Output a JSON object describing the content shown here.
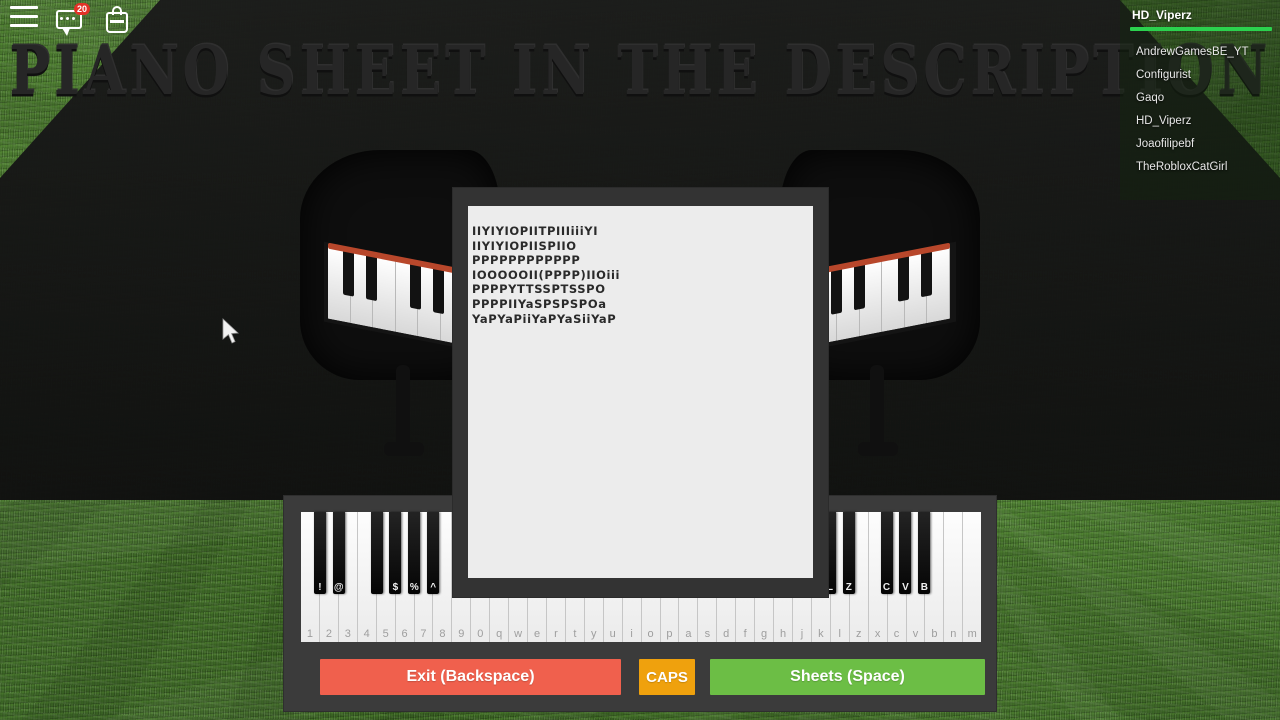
{
  "game": {
    "banner_text": "PIANO SHEET IN THE DESCRIPTION",
    "accent_colors": {
      "grass": "#3f6b2a",
      "backdrop": "#171717",
      "exit_button": "#f0604d",
      "caps_button": "#efa10d",
      "sheets_button": "#6cbe45",
      "health_bar": "#2bd14e",
      "chat_badge": "#e33227",
      "piano_felt": "#b8472b",
      "sheet_paper": "#ececec",
      "gui_frame": "#3b3b3b"
    }
  },
  "topbar": {
    "menu_icon": "hamburger-menu-icon",
    "chat_icon": "chat-bubble-icon",
    "chat_badge_count": "20",
    "backpack_icon": "backpack-icon"
  },
  "playerlist": {
    "local_player": "HD_Viperz",
    "health_percent": 100,
    "players": [
      {
        "name": "AndrewGamesBE_YT"
      },
      {
        "name": "Configurist"
      },
      {
        "name": "Gaqo"
      },
      {
        "name": "HD_Viperz"
      },
      {
        "name": "Joaofilipebf"
      },
      {
        "name": "TheRobloxCatGirl"
      }
    ]
  },
  "sheet": {
    "title": "piano-sheet-panel",
    "lines": [
      "IIYIYIOPIITPIIIiiiYI",
      "IIYIYIOPIISPIIO",
      "PPPPPPPPPPPP",
      "IOOOOOII(PPPP)IIOiii",
      "PPPPYTTSSPTSSPO",
      "PPPPIIYaSPSPSPOa",
      "YaPYaPiiYaPYaSiiYaP"
    ],
    "text": "IIYIYIOPIITPIIIiiiYI\nIIYIYIOPIISPIIO\nPPPPPPPPPPPP\nIOOOOOII(PPPP)IIOiii\nPPPPYTTSSPTSSPO\nPPPPIIYaSPSPSPOa\nYaPYaPiiYaPYaSiiYaP"
  },
  "piano": {
    "white_keys": [
      "1",
      "2",
      "3",
      "4",
      "5",
      "6",
      "7",
      "8",
      "9",
      "0",
      "q",
      "w",
      "e",
      "r",
      "t",
      "y",
      "u",
      "i",
      "o",
      "p",
      "a",
      "s",
      "d",
      "f",
      "g",
      "h",
      "j",
      "k",
      "l",
      "z",
      "x",
      "c",
      "v",
      "b",
      "n",
      "m"
    ],
    "black_keys": [
      {
        "label": "!",
        "after_white_index": 0
      },
      {
        "label": "@",
        "after_white_index": 1
      },
      {
        "label": "",
        "after_white_index": 3
      },
      {
        "label": "$",
        "after_white_index": 4
      },
      {
        "label": "%",
        "after_white_index": 5
      },
      {
        "label": "^",
        "after_white_index": 6
      },
      {
        "label": "",
        "after_white_index": 8
      },
      {
        "label": "",
        "after_white_index": 10
      },
      {
        "label": "",
        "after_white_index": 11
      },
      {
        "label": "",
        "after_white_index": 13
      },
      {
        "label": "",
        "after_white_index": 14
      },
      {
        "label": "",
        "after_white_index": 15
      },
      {
        "label": "",
        "after_white_index": 17
      },
      {
        "label": "",
        "after_white_index": 18
      },
      {
        "label": "",
        "after_white_index": 20
      },
      {
        "label": "",
        "after_white_index": 21
      },
      {
        "label": "",
        "after_white_index": 22
      },
      {
        "label": "",
        "after_white_index": 24
      },
      {
        "label": "",
        "after_white_index": 25
      },
      {
        "label": "L",
        "after_white_index": 27
      },
      {
        "label": "Z",
        "after_white_index": 28
      },
      {
        "label": "C",
        "after_white_index": 30
      },
      {
        "label": "V",
        "after_white_index": 31
      },
      {
        "label": "B",
        "after_white_index": 32
      }
    ]
  },
  "buttons": {
    "exit": "Exit (Backspace)",
    "caps": "CAPS",
    "sheets": "Sheets (Space)"
  }
}
